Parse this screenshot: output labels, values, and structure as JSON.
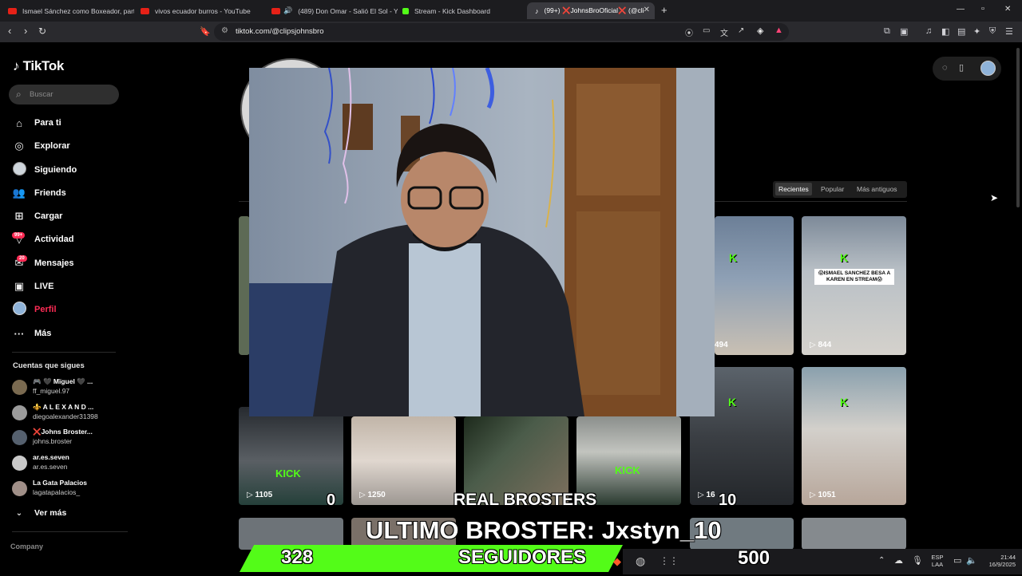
{
  "browser": {
    "tabs": [
      {
        "label": "Ismael Sánchez como Boxeador, part",
        "favicon_color": "#e62117"
      },
      {
        "label": "vivos ecuador burros - YouTube",
        "favicon_color": "#e62117"
      },
      {
        "label": "(489) Don Omar - Salió El Sol - Yo",
        "favicon_color": "#e62117"
      },
      {
        "label": "Stream - Kick Dashboard",
        "favicon_color": "#53fc18"
      },
      {
        "label": "(99+) ❌JohnsBroOficial❌ (@cli",
        "favicon_color": "#ffffff"
      }
    ],
    "url": "tiktok.com/@clipsjohnsbro",
    "new_tab": "+",
    "window_controls": [
      "—",
      "▫",
      "✕"
    ]
  },
  "sidebar": {
    "logo": "TikTok",
    "search_placeholder": "Buscar",
    "nav": [
      {
        "label": "Para ti",
        "icon": "home-icon"
      },
      {
        "label": "Explorar",
        "icon": "compass-icon"
      },
      {
        "label": "Siguiendo",
        "icon": "following-avatar-icon"
      },
      {
        "label": "Friends",
        "icon": "friends-icon"
      },
      {
        "label": "Cargar",
        "icon": "upload-icon"
      },
      {
        "label": "Actividad",
        "icon": "activity-icon",
        "badge": "99+"
      },
      {
        "label": "Mensajes",
        "icon": "messages-icon",
        "badge": "20"
      },
      {
        "label": "LIVE",
        "icon": "live-icon"
      },
      {
        "label": "Perfil",
        "icon": "profile-avatar-icon"
      },
      {
        "label": "Más",
        "icon": "more-icon"
      }
    ],
    "following_heading": "Cuentas que sigues",
    "following": [
      {
        "name": "🎮 🖤 Mïguel 🖤 ...",
        "handle": "ff_miguel.97"
      },
      {
        "name": "⚜️ A L E X A N D ...",
        "handle": "diegoalexander31398"
      },
      {
        "name": "❌Johns Broster...",
        "handle": "johns.broster"
      },
      {
        "name": "ar.es.seven",
        "handle": "ar.es.seven"
      },
      {
        "name": "La Gata Palacios",
        "handle": "lagatapalacios_"
      }
    ],
    "see_more": "Ver más",
    "company": "Company"
  },
  "profile": {
    "filters": [
      "Recientes",
      "Popular",
      "Más antiguos"
    ],
    "active_filter": "Recientes",
    "thumb_captions": [
      "😱ISMAEL SANCHEZ BESA A KAREN EN STREAM😱"
    ],
    "view_counts": [
      "494",
      "844",
      "1105",
      "1250",
      "1051"
    ],
    "partial_counts": [
      "16"
    ]
  },
  "overlay": {
    "counter_left": "0",
    "counter_right": "10",
    "real_brosters": "REAL BROSTERS",
    "last_broster": "ULTIMO BROSTER: Jxstyn_10",
    "followers_current": "328",
    "followers_label": "SEGUIDORES",
    "followers_goal": "500",
    "goal_progress": 0.656,
    "accent": "#53fc18"
  },
  "taskbar": {
    "lang_top": "ESP",
    "lang_bottom": "LAA",
    "time": "21:44",
    "date": "16/9/2025"
  }
}
